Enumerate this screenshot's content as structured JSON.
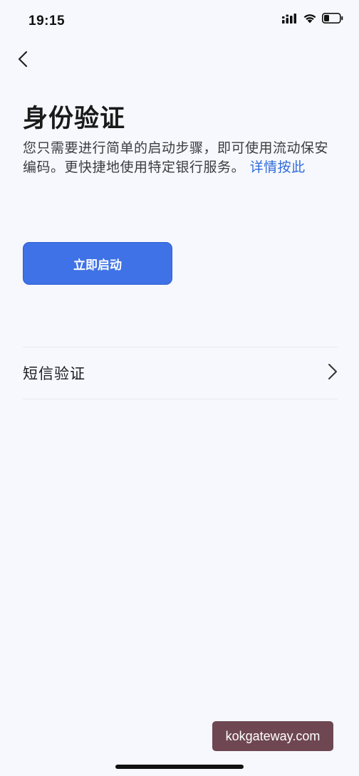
{
  "status_bar": {
    "time": "19:15",
    "icons": [
      "cellular-signal-icon",
      "wifi-icon",
      "battery-icon"
    ]
  },
  "navigation": {
    "back_icon": "chevron-left-icon"
  },
  "page": {
    "title": "身份验证",
    "description": "您只需要进行简单的启动步骤，即可使用流动保安编码。更快捷地使用特定银行服务。",
    "details_link": "详情按此",
    "start_button_label": "立即启动"
  },
  "options": {
    "sms_label": "短信验证",
    "sms_chevron_icon": "chevron-right-icon"
  },
  "watermark": {
    "text": "kokgateway.com"
  },
  "colors": {
    "background": "#f6f8fd",
    "primary": "#3f72e6",
    "link": "#2f6bd9",
    "watermark_bg": "#6e4753"
  }
}
